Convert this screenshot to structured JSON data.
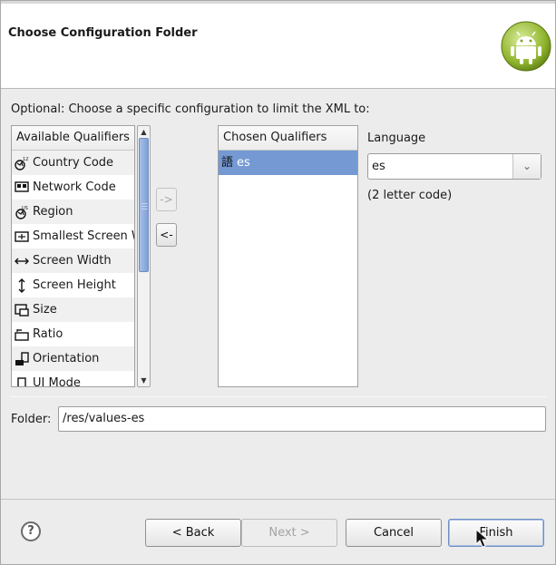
{
  "banner": {
    "title": "Choose Configuration Folder"
  },
  "optional_label": "Optional: Choose a specific configuration to limit the XML to:",
  "available": {
    "header": "Available Qualifiers",
    "items": [
      {
        "label": "Country Code",
        "icon": "globe-123-icon"
      },
      {
        "label": "Network Code",
        "icon": "network-icon"
      },
      {
        "label": "Region",
        "icon": "globe-region-icon"
      },
      {
        "label": "Smallest Screen Width",
        "icon": "smallest-width-icon"
      },
      {
        "label": "Screen Width",
        "icon": "width-arrows-icon"
      },
      {
        "label": "Screen Height",
        "icon": "height-arrows-icon"
      },
      {
        "label": "Size",
        "icon": "size-icon"
      },
      {
        "label": "Ratio",
        "icon": "ratio-icon"
      },
      {
        "label": "Orientation",
        "icon": "orientation-icon"
      },
      {
        "label": "UI Mode",
        "icon": "ui-mode-icon"
      }
    ]
  },
  "move_buttons": {
    "add": "->",
    "remove": "<-"
  },
  "chosen": {
    "header": "Chosen Qualifiers",
    "items": [
      {
        "label": "es",
        "icon": "language-icon"
      }
    ]
  },
  "language": {
    "label": "Language",
    "value": "es",
    "hint": "(2 letter code)"
  },
  "folder": {
    "label": "Folder:",
    "value": "/res/values-es"
  },
  "buttons": {
    "back": "< Back",
    "next": "Next >",
    "cancel": "Cancel",
    "finish": "Finish"
  },
  "colors": {
    "selection": "#7499d3",
    "android_green": "#a4c639"
  }
}
